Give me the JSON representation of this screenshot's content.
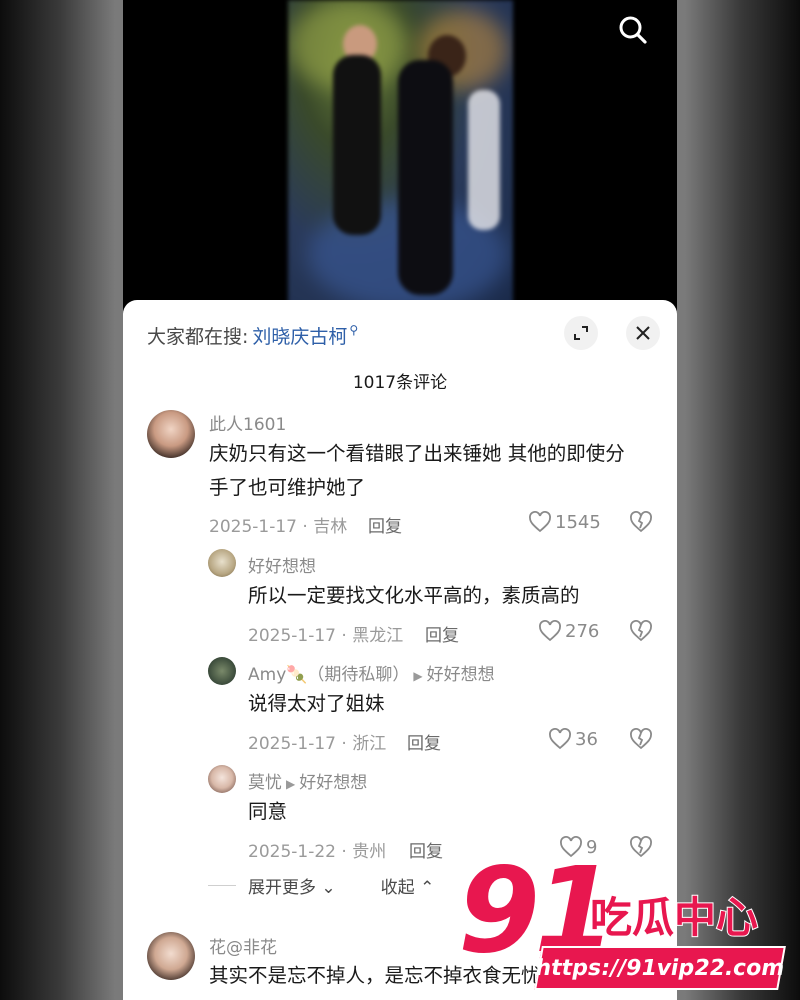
{
  "header": {
    "hot_search_prefix": "大家都在搜:",
    "hot_search_term": "刘晓庆古柯",
    "search_icon": "search-icon",
    "expand_icon": "expand-icon",
    "close_icon": "close-icon"
  },
  "comment_count": "1017条评论",
  "comments": [
    {
      "user": "此人1601",
      "text_line1": "庆奶只有这一个看错眼了出来锤她 其他的即使分",
      "text_line2": "手了也可维护她了",
      "meta": "2025-1-17 · 吉林",
      "reply": "回复",
      "likes": "1545"
    },
    {
      "user": "好好想想",
      "text": "所以一定要找文化水平高的，素质高的",
      "meta": "2025-1-17 · 黑龙江",
      "reply": "回复",
      "likes": "276"
    },
    {
      "user": "Amy🍡（期待私聊）",
      "reply_to": "好好想想",
      "text": "说得太对了姐妹",
      "meta": "2025-1-17 · 浙江",
      "reply": "回复",
      "likes": "36"
    },
    {
      "user": "莫忧",
      "reply_to": "好好想想",
      "text": "同意",
      "meta": "2025-1-22 · 贵州",
      "reply": "回复",
      "likes": "9"
    },
    {
      "user": "花@非花",
      "text": "其实不是忘不掉人，是忘不掉衣食无忧的日子"
    }
  ],
  "thread_controls": {
    "expand": "展开更多",
    "collapse": "收起"
  },
  "watermark": {
    "number": "91",
    "name": "吃瓜中心",
    "url": "https://91vip22.com"
  },
  "colors": {
    "accent_link": "#2e5fa8",
    "watermark": "#e8174f"
  }
}
